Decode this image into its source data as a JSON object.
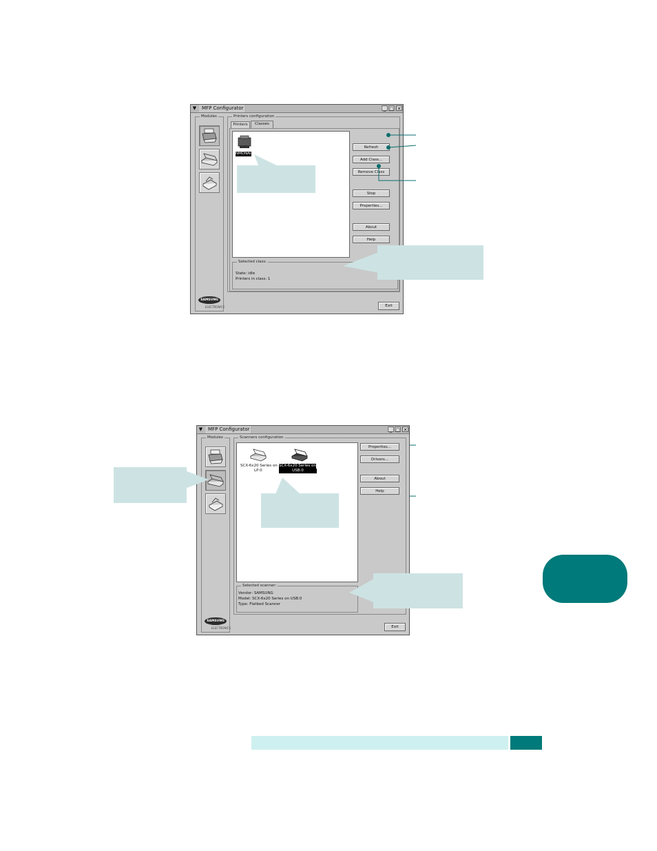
{
  "window1": {
    "title": "MFP Configurator",
    "menu_glyph": "▼",
    "controls": {
      "minimize": "_",
      "maximize": "□",
      "close": "✕"
    },
    "modules_label": "Modules",
    "config_label": "Printers configuration",
    "tabs": [
      "Printers",
      "Classes"
    ],
    "class_item": "NMDNAI",
    "buttons": {
      "refresh": "Refresh",
      "add_class": "Add Class...",
      "remove_class": "Remove Class",
      "stop": "Stop",
      "properties": "Properties...",
      "about": "About",
      "help": "Help",
      "exit": "Exit"
    },
    "selected_label": "Selected class:",
    "state": "State: idle",
    "printers_in_class": "Printers in class: 1",
    "logo": "SAMSUNG",
    "logo_sub": "ELECTRONICS"
  },
  "window2": {
    "title": "MFP Configurator",
    "menu_glyph": "▼",
    "controls": {
      "minimize": "_",
      "maximize": "□",
      "close": "✕"
    },
    "modules_label": "Modules",
    "config_label": "Scanners configuration",
    "scanner1_line1": "SCX-6x20 Series on",
    "scanner1_line2": "LP:0",
    "scanner2_line1": "SCX-6x20 Series on",
    "scanner2_line2": "USB:0",
    "buttons": {
      "properties": "Properties...",
      "drivers": "Drivers...",
      "about": "About",
      "help": "Help",
      "exit": "Exit"
    },
    "selected_label": "Selected scanner:",
    "vendor": "Vendor: SAMSUNG",
    "model": "Model: SCX-6x20 Series on USB:0",
    "type": "Type: Flatbed Scanner",
    "logo": "SAMSUNG",
    "logo_sub": "ELECTRONICS"
  },
  "colors": {
    "callout": "#cde3e3",
    "leader": "#0a6d6d",
    "tab_badge": "#007a7a",
    "footer_bar": "#cff0f0",
    "footer_block": "#007a7a"
  }
}
